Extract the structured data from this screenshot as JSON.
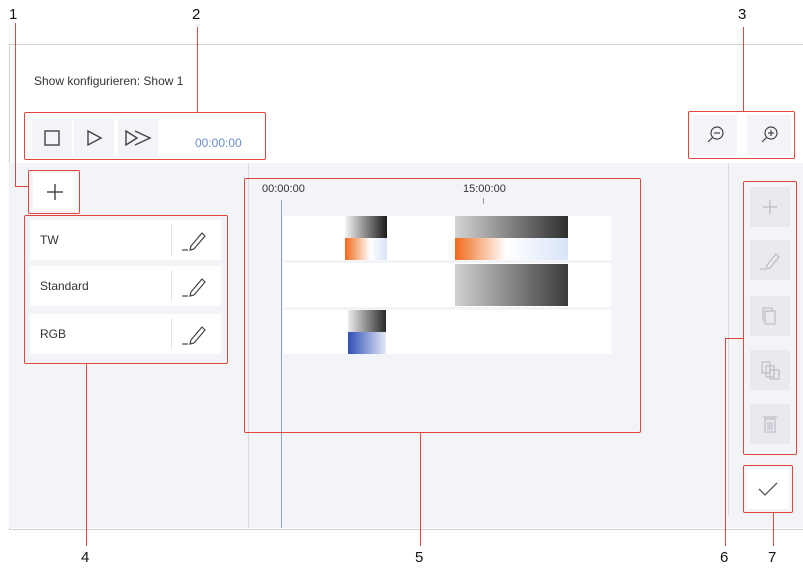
{
  "header": {
    "title": "Show konfigurieren: Show 1"
  },
  "transport": {
    "time": "00:00:00"
  },
  "timeline": {
    "start_label": "00:00:00",
    "mid_label": "15:00:00"
  },
  "groups": [
    {
      "label": "TW"
    },
    {
      "label": "Standard"
    },
    {
      "label": "RGB"
    }
  ],
  "callouts": [
    "1",
    "2",
    "3",
    "4",
    "5",
    "6",
    "7"
  ],
  "colors": {
    "highlight": "#e0463c",
    "accent_time": "#6a8ccc",
    "orange": "#f06a1a",
    "blue": "#3d5ec6"
  }
}
